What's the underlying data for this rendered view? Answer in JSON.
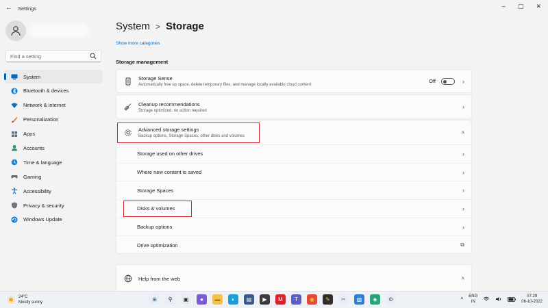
{
  "window": {
    "title": "Settings",
    "controls": {
      "minimize": "–",
      "maximize": "▢",
      "close": "✕"
    }
  },
  "search": {
    "placeholder": "Find a setting",
    "value": ""
  },
  "sidebar": {
    "items": [
      {
        "label": "System",
        "icon": "system-icon",
        "active": true,
        "color": "#0067c0"
      },
      {
        "label": "Bluetooth & devices",
        "icon": "bluetooth-icon",
        "color": "#0078d4"
      },
      {
        "label": "Network & internet",
        "icon": "network-icon",
        "color": "#0a6fc2"
      },
      {
        "label": "Personalization",
        "icon": "brush-icon",
        "color": "#c37b37"
      },
      {
        "label": "Apps",
        "icon": "apps-icon",
        "color": "#5f6c7b"
      },
      {
        "label": "Accounts",
        "icon": "accounts-icon",
        "color": "#2b9a66"
      },
      {
        "label": "Time & language",
        "icon": "globe-clock-icon",
        "color": "#1a86d0"
      },
      {
        "label": "Gaming",
        "icon": "gaming-icon",
        "color": "#6b6b6b"
      },
      {
        "label": "Accessibility",
        "icon": "accessibility-icon",
        "color": "#1a73c9"
      },
      {
        "label": "Privacy & security",
        "icon": "shield-icon",
        "color": "#6f7780"
      },
      {
        "label": "Windows Update",
        "icon": "update-icon",
        "color": "#0a74d1"
      }
    ]
  },
  "breadcrumb": {
    "parent": "System",
    "separator": ">",
    "current": "Storage"
  },
  "main": {
    "more_categories": "Show more categories",
    "section_title": "Storage management",
    "storage_sense": {
      "title": "Storage Sense",
      "desc": "Automatically free up space, delete temporary files, and manage locally available cloud content",
      "toggle_label": "Off",
      "toggle_on": false
    },
    "cleanup": {
      "title": "Cleanup recommendations",
      "desc": "Storage optimized, no action required"
    },
    "advanced": {
      "title": "Advanced storage settings",
      "desc": "Backup options, Storage Spaces, other disks and volumes",
      "expanded": true,
      "sub_items": [
        {
          "label": "Storage used on other drives",
          "chevron": "›"
        },
        {
          "label": "Where new content is saved",
          "chevron": "›"
        },
        {
          "label": "Storage Spaces",
          "chevron": "›"
        },
        {
          "label": "Disks & volumes",
          "chevron": "›"
        },
        {
          "label": "Backup options",
          "chevron": "›"
        },
        {
          "label": "Drive optimization",
          "chevron": "⧉"
        }
      ]
    },
    "help": {
      "title": "Help from the web"
    }
  },
  "taskbar": {
    "weather": {
      "temp": "24°C",
      "condition": "Mostly sunny"
    },
    "apps": [
      {
        "icon": "windows-start-icon",
        "glyph": "⊞",
        "bg": "#e9eef6",
        "fg": "#0078d4"
      },
      {
        "icon": "search-icon",
        "glyph": "⚲",
        "bg": "#e9eef6",
        "fg": "#111111"
      },
      {
        "icon": "task-view-icon",
        "glyph": "▣",
        "bg": "#e9eef6",
        "fg": "#333333"
      },
      {
        "icon": "chat-icon",
        "glyph": "●",
        "bg": "#7b5cd6",
        "fg": "#ffffff"
      },
      {
        "icon": "file-explorer-icon",
        "glyph": "▬",
        "bg": "#f2c14e",
        "fg": "#b37a00"
      },
      {
        "icon": "edge-icon",
        "glyph": "◐",
        "bg": "#1a9fd9",
        "fg": "#ffffff"
      },
      {
        "icon": "store-icon",
        "glyph": "▤",
        "bg": "#3a5a8c",
        "fg": "#ffffff"
      },
      {
        "icon": "media-icon",
        "glyph": "▶",
        "bg": "#3b3b3b",
        "fg": "#ffffff"
      },
      {
        "icon": "mcafee-icon",
        "glyph": "M",
        "bg": "#d6222a",
        "fg": "#ffffff"
      },
      {
        "icon": "teams-icon",
        "glyph": "T",
        "bg": "#5b5fc7",
        "fg": "#ffffff"
      },
      {
        "icon": "chrome-icon",
        "glyph": "◉",
        "bg": "#e04a3a",
        "fg": "#f7c32e"
      },
      {
        "icon": "notes-icon",
        "glyph": "✎",
        "bg": "#2f2f2f",
        "fg": "#f2c14e"
      },
      {
        "icon": "snipping-icon",
        "glyph": "✂",
        "bg": "#e9eef6",
        "fg": "#4a6fa5"
      },
      {
        "icon": "photos-icon",
        "glyph": "▧",
        "bg": "#2f7fd3",
        "fg": "#ffffff"
      },
      {
        "icon": "maps-icon",
        "glyph": "◈",
        "bg": "#2aa37a",
        "fg": "#ffffff"
      },
      {
        "icon": "settings-icon",
        "glyph": "⚙",
        "bg": "#e9eef6",
        "fg": "#555555"
      }
    ],
    "tray": {
      "chevron": "^",
      "lang_top": "ENG",
      "lang_bottom": "IN",
      "time": "07:29",
      "date": "06-10-2022"
    }
  },
  "colors": {
    "accent": "#0067c0",
    "highlight": "#d6222a"
  }
}
